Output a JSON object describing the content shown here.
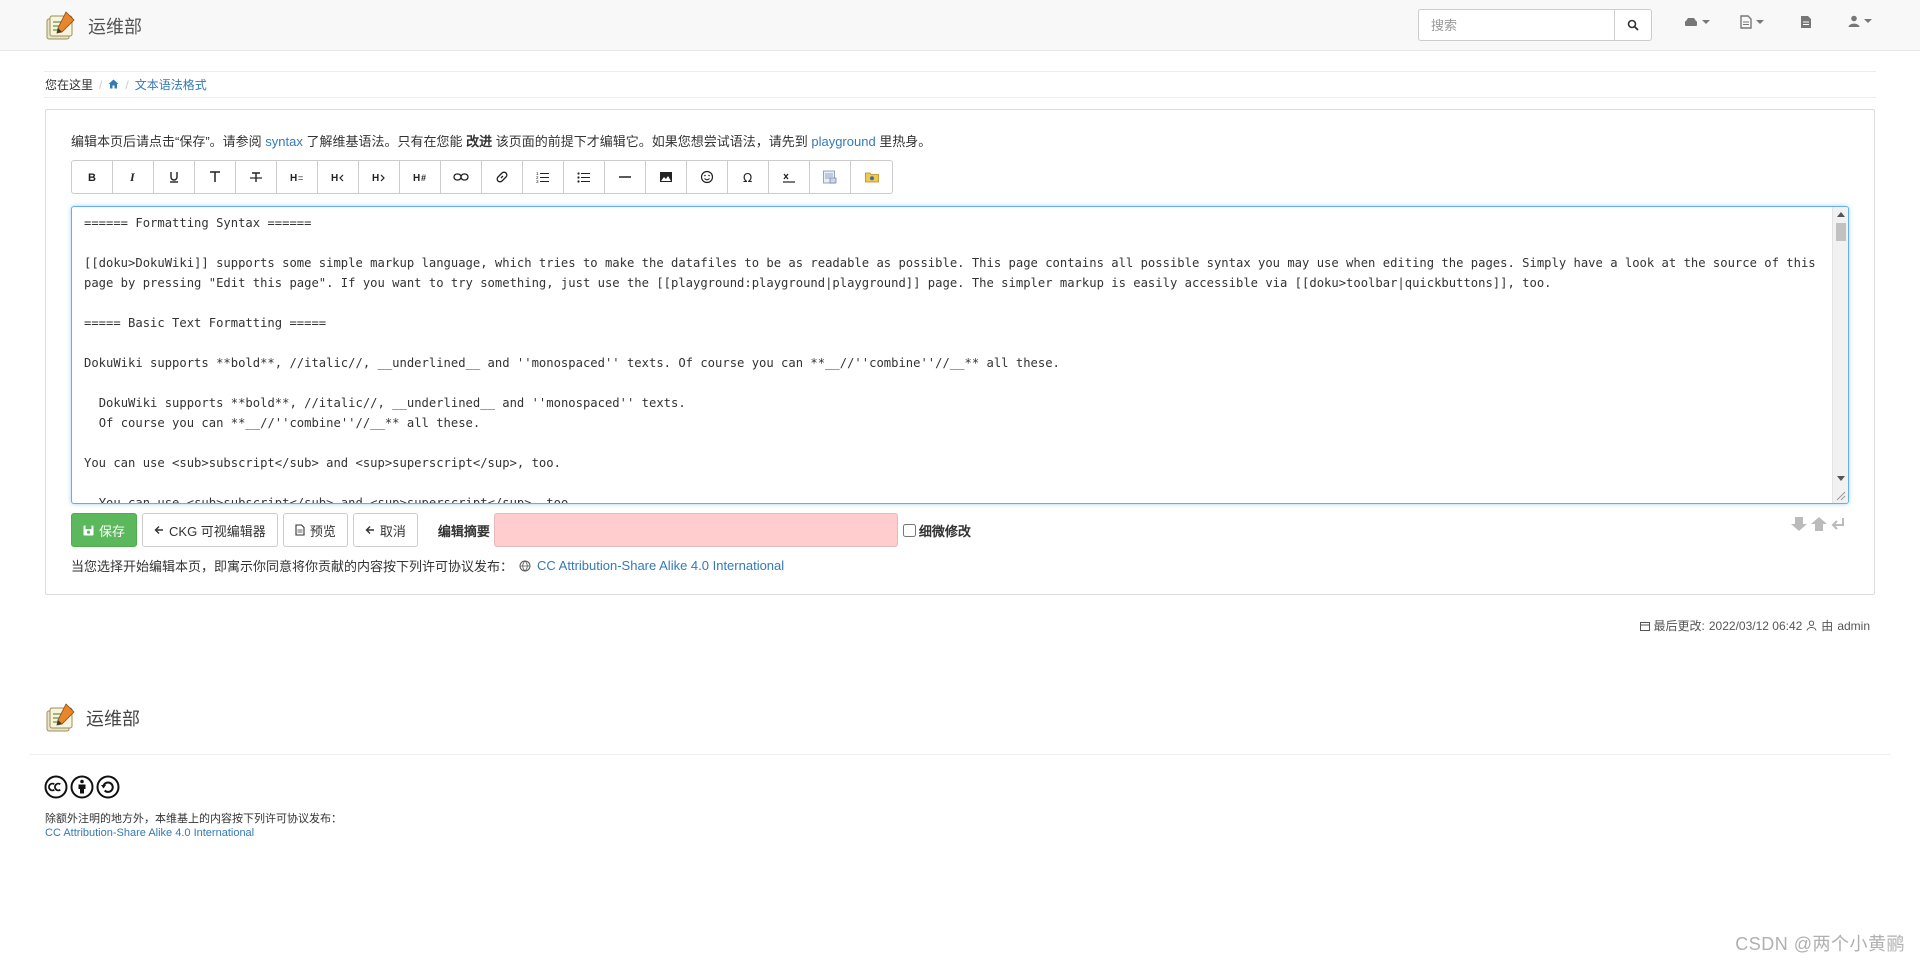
{
  "navbar": {
    "site_title": "运维部",
    "search_placeholder": "搜索"
  },
  "breadcrumb": {
    "prefix": "您在这里",
    "sep": "/",
    "current": "文本语法格式"
  },
  "intro": {
    "part1": "编辑本页后请点击“保存”。请参阅 ",
    "link1": "syntax",
    "part2": " 了解维基语法。只有在您能 ",
    "bold": "改进",
    "part3": " 该页面的前提下才编辑它。如果您想尝试语法，请先到 ",
    "link2": "playground",
    "part4": " 里热身。"
  },
  "toolbar": {
    "buttons": [
      "bold-icon",
      "italic-icon",
      "underline-icon",
      "monospace-icon",
      "strikethrough-icon",
      "heading-same-icon",
      "heading-higher-icon",
      "heading-lower-icon",
      "heading-select-icon",
      "internal-link-icon",
      "external-link-icon",
      "ordered-list-icon",
      "unordered-list-icon",
      "horizontal-rule-icon",
      "image-icon",
      "smiley-icon",
      "special-chars-icon",
      "signature-icon",
      "media-manager-icon",
      "plugin-icon"
    ]
  },
  "editor": {
    "content": "====== Formatting Syntax ======\n\n[[doku>DokuWiki]] supports some simple markup language, which tries to make the datafiles to be as readable as possible. This page contains all possible syntax you may use when editing the pages. Simply have a look at the source of this page by pressing \"Edit this page\". If you want to try something, just use the [[playground:playground|playground]] page. The simpler markup is easily accessible via [[doku>toolbar|quickbuttons]], too.\n\n===== Basic Text Formatting =====\n\nDokuWiki supports **bold**, //italic//, __underlined__ and ''monospaced'' texts. Of course you can **__//''combine''//__** all these.\n\n  DokuWiki supports **bold**, //italic//, __underlined__ and ''monospaced'' texts.\n  Of course you can **__//''combine''//__** all these.\n\nYou can use <sub>subscript</sub> and <sup>superscript</sup>, too.\n\n  You can use <sub>subscript</sub> and <sup>superscript</sup>, too."
  },
  "actions": {
    "save": "保存",
    "ckg": "CKG 可视编辑器",
    "preview": "预览",
    "cancel": "取消",
    "summary_label": "编辑摘要",
    "minor_label": "细微修改"
  },
  "license": {
    "text": "当您选择开始编辑本页，即寓示你同意将你贡献的内容按下列许可协议发布：",
    "link": "CC Attribution-Share Alike 4.0 International"
  },
  "lastmod": {
    "label": "最后更改:",
    "date": "2022/03/12 06:42",
    "by": "由",
    "user": "admin"
  },
  "footer": {
    "site_title": "运维部",
    "note": "除额外注明的地方外，本维基上的内容按下列许可协议发布：",
    "link": "CC Attribution-Share Alike 4.0 International"
  },
  "watermark": "CSDN @两个小黄鹂",
  "colors": {
    "link": "#337ab7",
    "save_button": "#5cb85c",
    "summary_invalid": "#ffcdcd",
    "editor_focus": "#66afe9"
  }
}
